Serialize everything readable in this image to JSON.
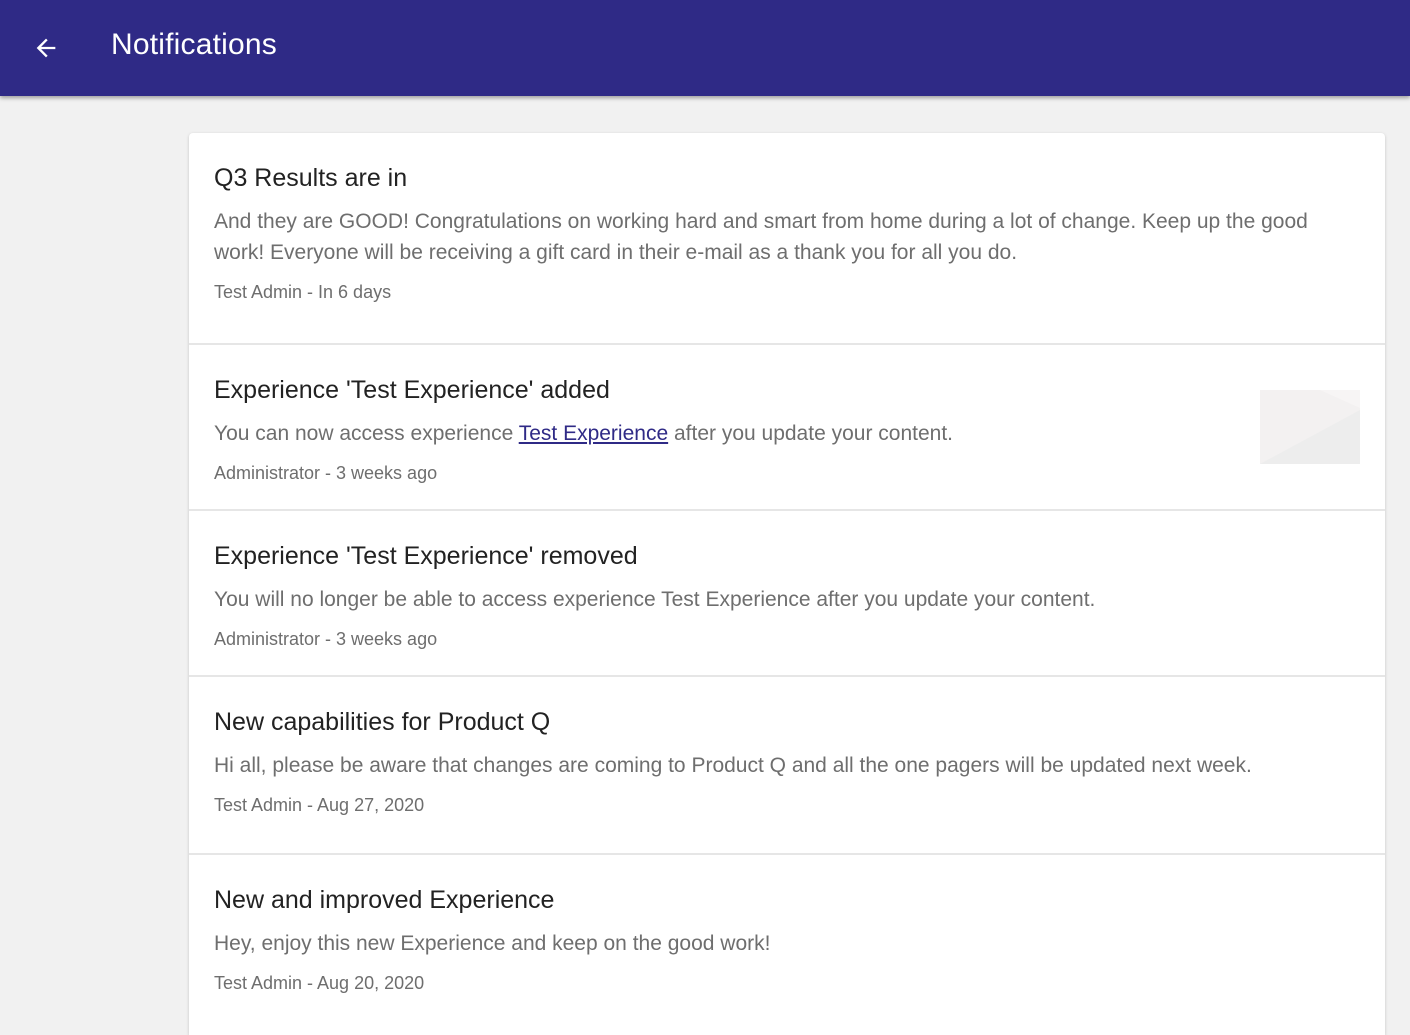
{
  "header": {
    "title": "Notifications",
    "back_icon": "arrow-left-icon",
    "background_color": "#2f2a86"
  },
  "notifications": [
    {
      "title": "Q3 Results are in",
      "body": "And they are GOOD! Congratulations on working hard and smart from home during a lot of change. Keep up the good work! Everyone will be receiving a gift card in their e-mail as a thank you for all you do.",
      "meta": "Test Admin - In 6 days"
    },
    {
      "title": "Experience 'Test Experience' added",
      "body_prefix": "You can now access experience ",
      "body_link": "Test Experience",
      "body_suffix": " after you update your content.",
      "meta": "Administrator - 3 weeks ago",
      "thumbnail_icon": "image-placeholder-icon"
    },
    {
      "title": "Experience 'Test Experience' removed",
      "body": "You will no longer be able to access experience Test Experience after you update your content.",
      "meta": "Administrator - 3 weeks ago"
    },
    {
      "title": "New capabilities for Product Q",
      "body": "Hi all, please be aware that changes are coming to Product Q and all the one pagers will be updated next week.",
      "meta": "Test Admin - Aug 27, 2020"
    },
    {
      "title": "New and improved Experience",
      "body": "Hey, enjoy this new Experience and keep on the good work!",
      "meta": "Test Admin - Aug 20, 2020"
    }
  ]
}
